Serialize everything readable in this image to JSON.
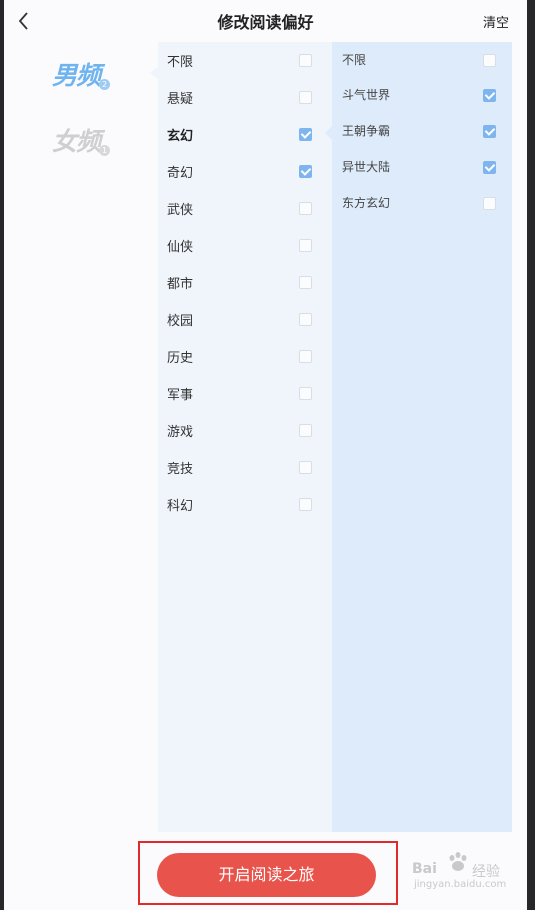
{
  "header": {
    "title": "修改阅读偏好",
    "clear_label": "清空"
  },
  "genders": [
    {
      "label": "男频",
      "badge": "2",
      "selected": true
    },
    {
      "label": "女频",
      "badge": "1",
      "selected": false
    }
  ],
  "categories": [
    {
      "label": "不限",
      "checked": false
    },
    {
      "label": "悬疑",
      "checked": false
    },
    {
      "label": "玄幻",
      "checked": true
    },
    {
      "label": "奇幻",
      "checked": true
    },
    {
      "label": "武侠",
      "checked": false
    },
    {
      "label": "仙侠",
      "checked": false
    },
    {
      "label": "都市",
      "checked": false
    },
    {
      "label": "校园",
      "checked": false
    },
    {
      "label": "历史",
      "checked": false
    },
    {
      "label": "军事",
      "checked": false
    },
    {
      "label": "游戏",
      "checked": false
    },
    {
      "label": "竞技",
      "checked": false
    },
    {
      "label": "科幻",
      "checked": false
    }
  ],
  "subcategories": [
    {
      "label": "不限",
      "checked": false
    },
    {
      "label": "斗气世界",
      "checked": true
    },
    {
      "label": "王朝争霸",
      "checked": true
    },
    {
      "label": "异世大陆",
      "checked": true
    },
    {
      "label": "东方玄幻",
      "checked": false
    }
  ],
  "footer": {
    "start_button_label": "开启阅读之旅"
  },
  "watermark": {
    "brand": "Bai",
    "suffix": "经验",
    "url": "jingyan.baidu.com"
  },
  "colors": {
    "accent": "#7fb5ee",
    "button": "#e8544c",
    "annotation": "#e32a2a"
  },
  "icons": {
    "back": "chevron-left-icon",
    "checkbox": "checkbox-icon"
  }
}
